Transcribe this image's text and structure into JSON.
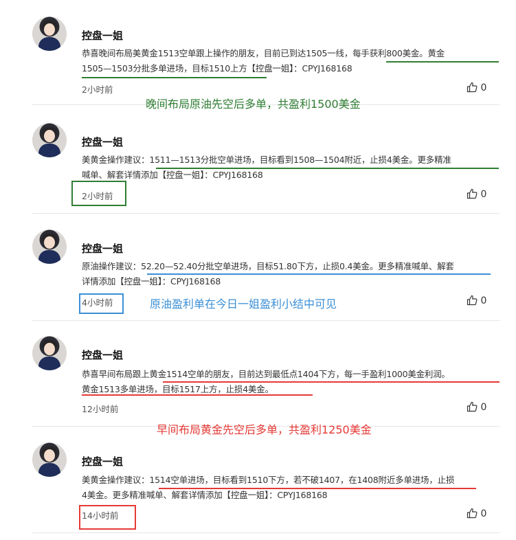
{
  "colors": {
    "green": "#2e7d32",
    "blue": "#3a8fd6",
    "red": "#e53935"
  },
  "posts": [
    {
      "author": "控盘一姐",
      "line1": "恭喜晚间布局美黄金1513空单跟上操作的朋友，目前已到达1505一线，每手获利800美金。黄金",
      "line2": "1505—1503分批多单进场，目标1510上方【控盘一姐】：CPYJ168168",
      "time": "2小时前",
      "likes": "0",
      "avatar_icon": "avatar-woman-icon"
    },
    {
      "author": "控盘一姐",
      "line1": "美黄金操作建议：1511—1513分批空单进场，目标看到1508—1504附近，止损4美金。更多精准",
      "line2": "喊单、解套详情添加【控盘一姐】：CPYJ168168",
      "time": "2小时前",
      "likes": "0",
      "avatar_icon": "avatar-woman-icon"
    },
    {
      "author": "控盘一姐",
      "line1": "原油操作建议：52.20—52.40分批空单进场，目标51.80下方，止损0.4美金。更多精准喊单、解套",
      "line2": "详情添加【控盘一姐】：CPYJ168168",
      "time": "4小时前",
      "likes": "0",
      "avatar_icon": "avatar-woman-icon"
    },
    {
      "author": "控盘一姐",
      "line1": "恭喜早间布局跟上黄金1514空单的朋友，目前达到最低点1404下方，每一手盈利1000美金利润。",
      "line2": "黄金1513多单进场，目标1517上方，止损4美金。",
      "time": "12小时前",
      "likes": "0",
      "avatar_icon": "avatar-woman-icon"
    },
    {
      "author": "控盘一姐",
      "line1": "美黄金操作建议：1514空单进场，目标看到1510下方，若不破1407，在1408附近多单进场，止损",
      "line2": "4美金。更多精准喊单、解套详情添加【控盘一姐】：CPYJ168168",
      "time": "14小时前",
      "likes": "0",
      "avatar_icon": "avatar-woman-icon"
    }
  ],
  "annotations": {
    "green_note": "晚间布局原油先空后多单，共盈利1500美金",
    "blue_note": "原油盈利单在今日一姐盈利小结中可见",
    "red_note": "早间布局黄金先空后多单，共盈利1250美金"
  },
  "like_icon": "thumbs-up-icon"
}
